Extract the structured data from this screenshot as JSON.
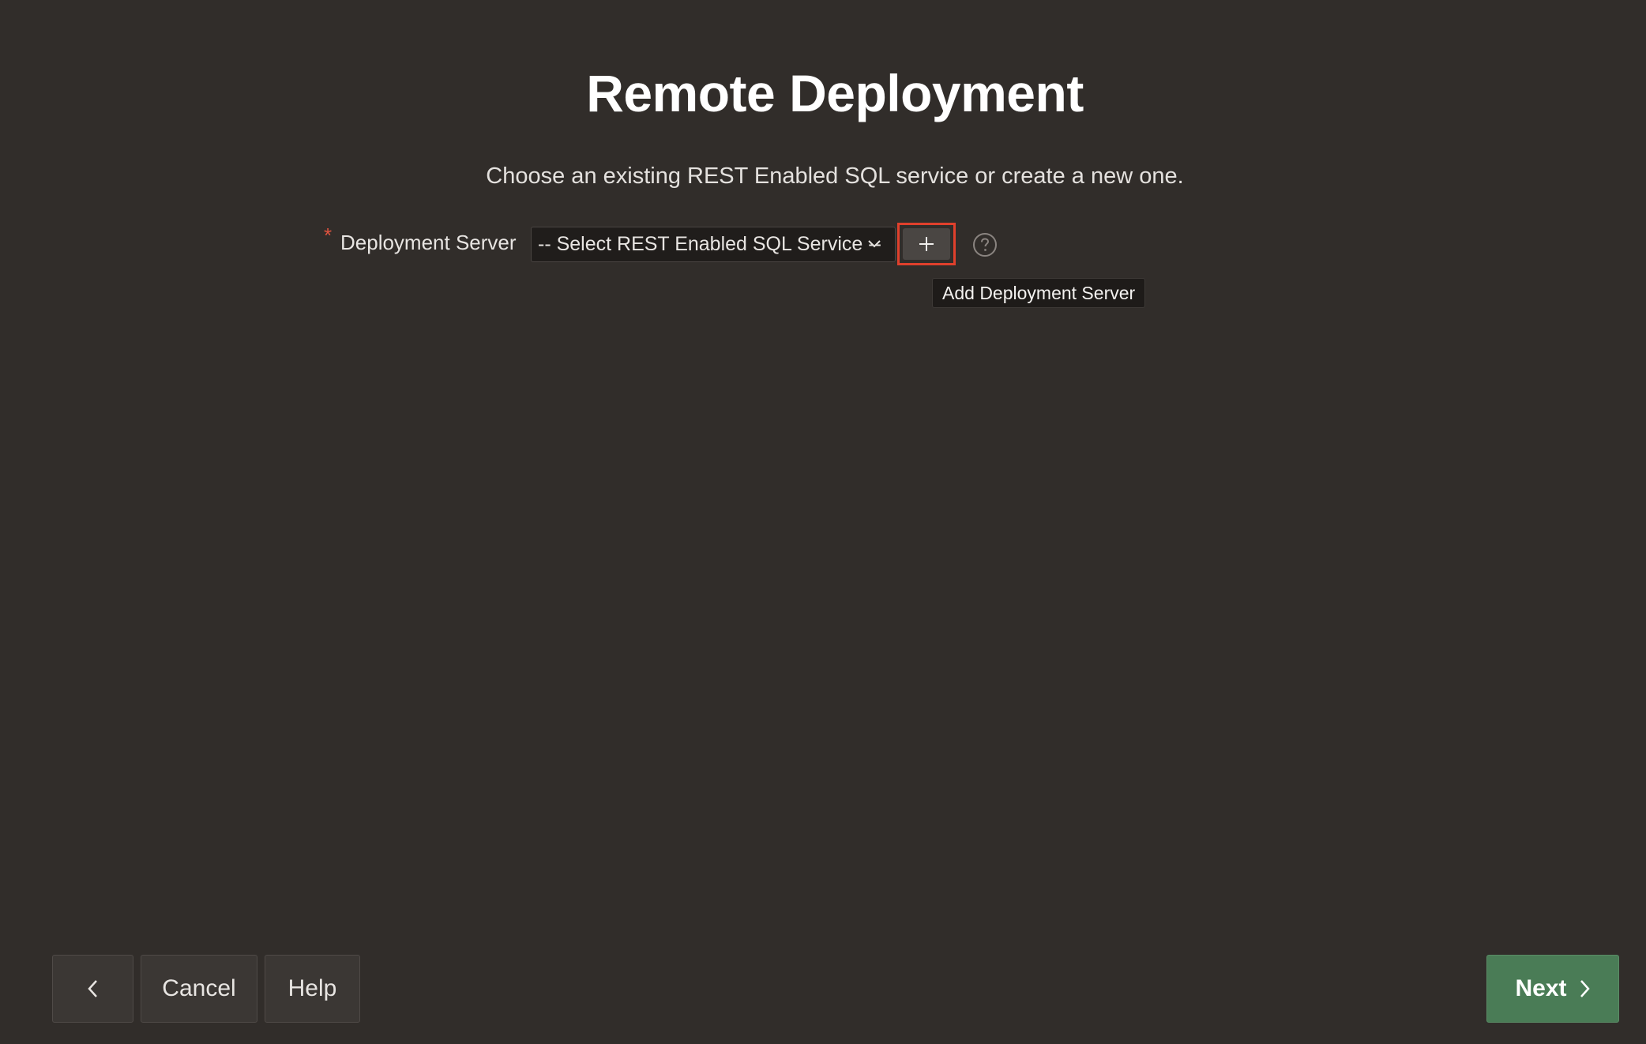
{
  "page": {
    "title": "Remote Deployment",
    "subtitle": "Choose an existing REST Enabled SQL service or create a new one."
  },
  "form": {
    "required_marker": "*",
    "field_label": "Deployment Server",
    "select_value": "-- Select REST Enabled SQL Service --",
    "add_button_icon": "plus-icon",
    "help_icon": "question-circle-icon",
    "tooltip": "Add Deployment Server"
  },
  "footer": {
    "back_icon": "chevron-left-icon",
    "cancel_label": "Cancel",
    "help_label": "Help",
    "next_label": "Next",
    "next_icon": "chevron-right-icon"
  },
  "colors": {
    "background": "#312d2a",
    "accent_next": "#4a7c56",
    "highlight_border": "#e0402c",
    "required": "#e0533f"
  }
}
